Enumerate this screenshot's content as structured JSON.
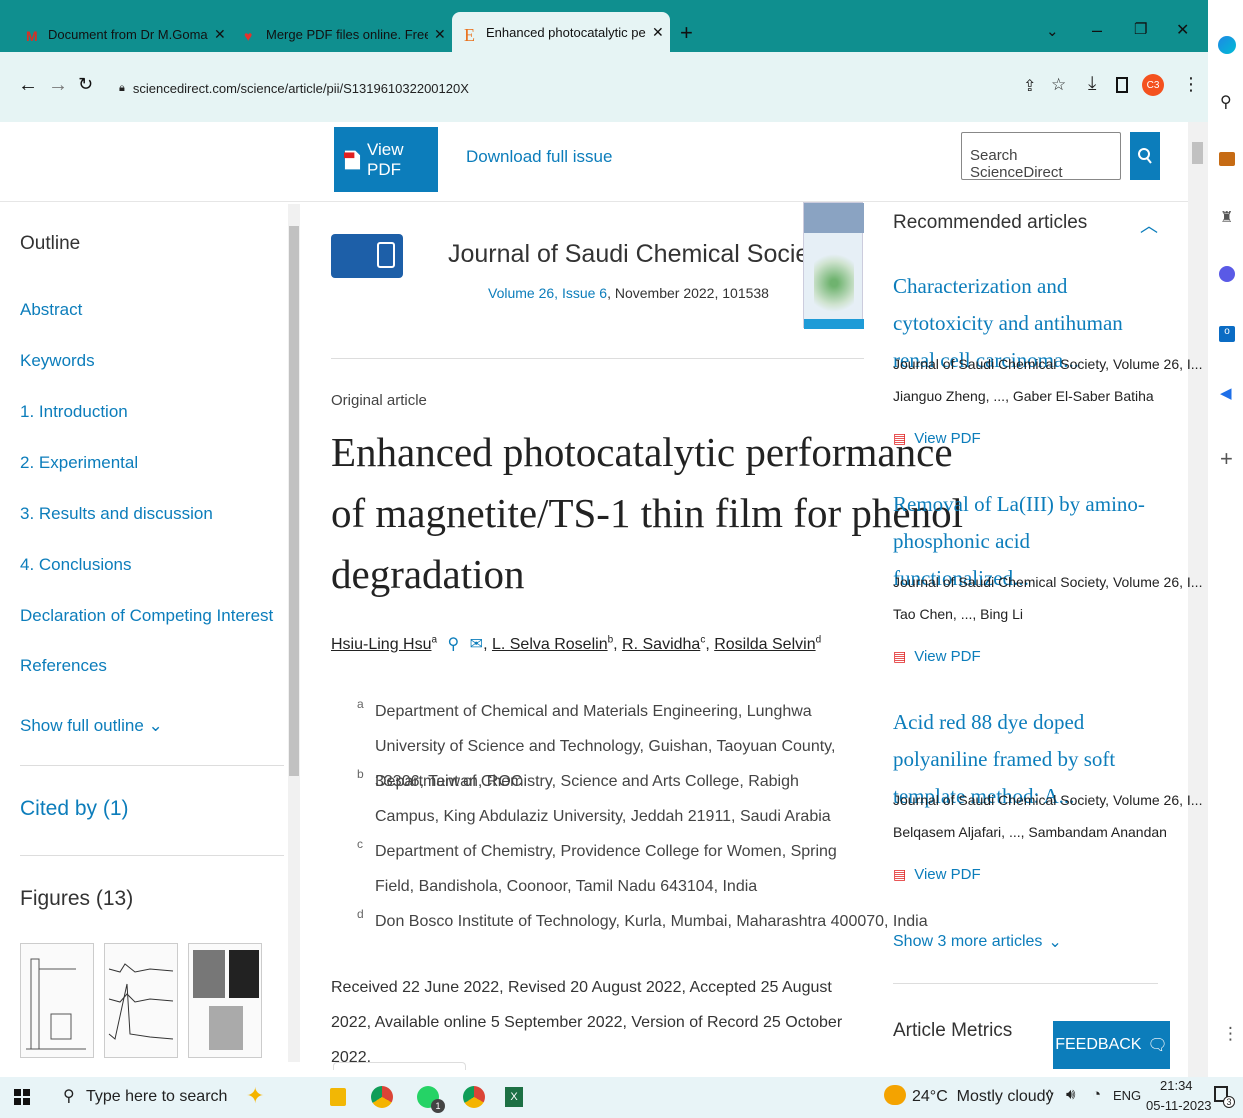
{
  "browser": {
    "tabs": [
      {
        "title": "Document from Dr M.Gomathi. -",
        "icon": "gmail-icon"
      },
      {
        "title": "Merge PDF files online. Free serv",
        "icon": "ilovepdf-icon"
      },
      {
        "title": "Enhanced photocatalytic perform",
        "icon": "elsevier-icon"
      }
    ],
    "new_tab": "+",
    "url": "sciencedirect.com/science/article/pii/S131961032200120X",
    "profile": "C3"
  },
  "header": {
    "view_pdf": "View PDF",
    "download_issue": "Download full issue",
    "search_placeholder": "Search ScienceDirect"
  },
  "outline": {
    "heading": "Outline",
    "items": [
      "Abstract",
      "Keywords",
      "1. Introduction",
      "2. Experimental",
      "3. Results and discussion",
      "4. Conclusions",
      "Declaration of Competing Interest",
      "References"
    ],
    "show_full": "Show full outline",
    "cited_by": "Cited by (1)",
    "figures": "Figures (13)"
  },
  "article": {
    "journal": "Journal of Saudi Chemical Society",
    "issue": "Volume 26, Issue 6",
    "issue_rest": ", November 2022, 101538",
    "type": "Original article",
    "title_lines": [
      "Enhanced photocatalytic performance",
      "of magnetite/TS-1 thin film for phenol",
      "degradation"
    ],
    "authors": [
      {
        "name": "Hsiu-Ling Hsu",
        "sup": "a"
      },
      {
        "name": "L. Selva Roselin",
        "sup": "b"
      },
      {
        "name": "R. Savidha",
        "sup": "c"
      },
      {
        "name": "Rosilda Selvin",
        "sup": "d"
      }
    ],
    "affiliations": [
      {
        "sup": "a",
        "text": "Department of Chemical and Materials Engineering, Lunghwa University of Science and Technology, Guishan, Taoyuan County, 33306, Taiwan, ROC"
      },
      {
        "sup": "b",
        "text": "Department of Chemistry, Science and Arts College, Rabigh Campus, King Abdulaziz University, Jeddah 21911, Saudi Arabia"
      },
      {
        "sup": "c",
        "text": "Department of Chemistry, Providence College for Women, Spring Field, Bandishola, Coonoor, Tamil Nadu 643104, India"
      },
      {
        "sup": "d",
        "text": "Don Bosco Institute of Technology, Kurla, Mumbai, Maharashtra 400070, India"
      }
    ],
    "history": "Received 22 June 2022, Revised 20 August 2022, Accepted 25 August 2022, Available online 5 September 2022, Version of Record 25 October 2022."
  },
  "recommended": {
    "heading": "Recommended articles",
    "items": [
      {
        "title": "Characterization and cytotoxicity and antihuman renal cell carcinoma...",
        "journal": "Journal of Saudi Chemical Society, Volume 26, I...",
        "authors": "Jianguo Zheng, ..., Gaber El-Saber Batiha",
        "pdf": "View PDF"
      },
      {
        "title": "Removal of La(III) by amino-phosphonic acid functionalized...",
        "journal": "Journal of Saudi Chemical Society, Volume 26, I...",
        "authors": "Tao Chen, ..., Bing Li",
        "pdf": "View PDF"
      },
      {
        "title": "Acid red 88 dye doped polyaniline framed by soft template method: A...",
        "journal": "Journal of Saudi Chemical Society, Volume 26, I...",
        "authors": "Belqasem Aljafari, ..., Sambandam Anandan",
        "pdf": "View PDF"
      }
    ],
    "show_more": "Show 3 more articles",
    "metrics": "Article Metrics",
    "feedback": "FEEDBACK"
  },
  "taskbar": {
    "search": "Type here to search",
    "weather": "24°C  Mostly cloudy",
    "lang": "ENG",
    "time": "21:34",
    "date": "05-11-2023",
    "notif": "3",
    "whatsapp_badge": "1"
  },
  "colors": {
    "accent": "#0c7dbb",
    "tabstrip": "#0f8f8f",
    "toolbar": "#e6f4f4"
  }
}
